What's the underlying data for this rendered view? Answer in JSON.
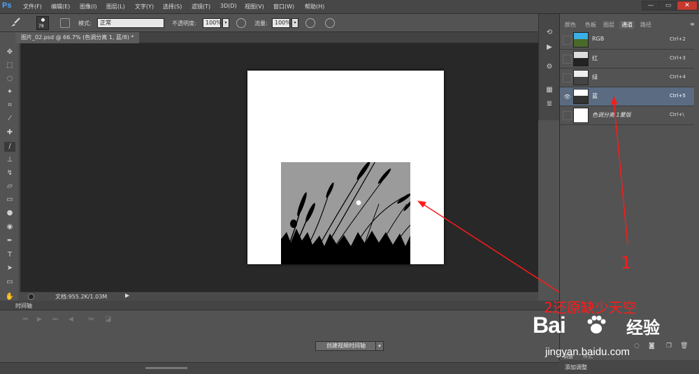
{
  "app": {
    "logo": "Ps"
  },
  "menu": [
    "文件(F)",
    "编辑(E)",
    "图像(I)",
    "图层(L)",
    "文字(Y)",
    "选择(S)",
    "滤镜(T)",
    "3D(D)",
    "视图(V)",
    "窗口(W)",
    "帮助(H)"
  ],
  "window_controls": [
    "—",
    "▭",
    "✕"
  ],
  "options": {
    "brush_size": "78",
    "mode_label": "模式:",
    "mode_value": "正常",
    "opacity_label": "不透明度:",
    "opacity_value": "100%",
    "flow_label": "流量:",
    "flow_value": "100%"
  },
  "document": {
    "tab_title": "图片_02.psd @ 66.7% (色调分离 1, 蓝/8) *",
    "status": "文档:955.2K/1.03M"
  },
  "timeline": {
    "title": "时间轴",
    "create_button": "创建视频时间轴"
  },
  "panel": {
    "tabs": [
      "颜色",
      "色板",
      "图层",
      "通道",
      "路径"
    ],
    "active_tab": "通道",
    "channels": [
      {
        "name": "RGB",
        "shortcut": "Ctrl+2"
      },
      {
        "name": "红",
        "shortcut": "Ctrl+3"
      },
      {
        "name": "绿",
        "shortcut": "Ctrl+4"
      },
      {
        "name": "蓝",
        "shortcut": "Ctrl+5"
      },
      {
        "name": "色调分离 1蒙版",
        "shortcut": "Ctrl+\\"
      }
    ],
    "selected_channel": "蓝",
    "bottom_tabs": [
      "调整",
      "样式"
    ],
    "bottom_text": "添加调整"
  },
  "annotations": {
    "label_1": "1",
    "label_2": "2还原缺少天空"
  },
  "watermark": {
    "brand": "Bai",
    "brand_cn": "经验",
    "url": "jingyan.baidu.com"
  },
  "colors": {
    "annotation_red": "#ff1a1a",
    "selected_row": "#5a6b82",
    "ps_blue": "#4fa3f7"
  }
}
